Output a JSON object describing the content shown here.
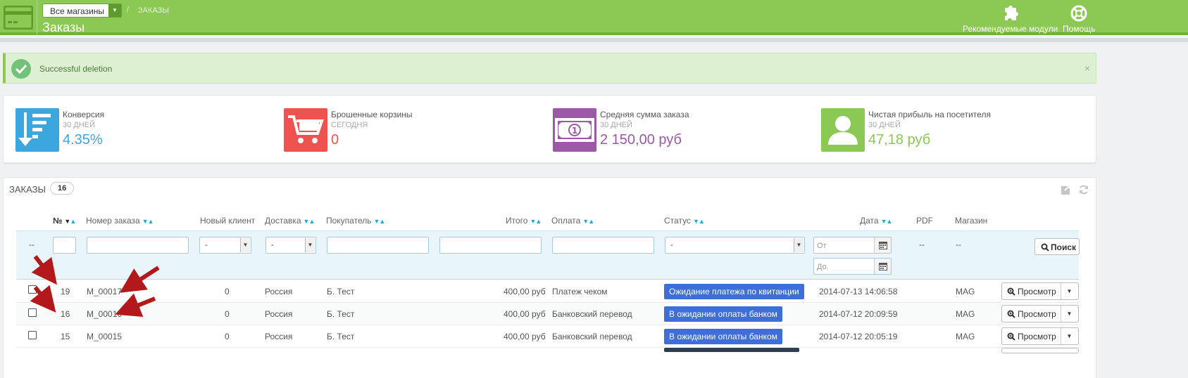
{
  "header": {
    "store_select": "Все магазины",
    "breadcrumb_sep": "/",
    "breadcrumb_current": "ЗАКАЗЫ",
    "page_title": "Заказы",
    "actions": [
      {
        "label": "Рекомендуемые модули",
        "icon": "puzzle-icon"
      },
      {
        "label": "Помощь",
        "icon": "lifebuoy-icon"
      }
    ],
    "color": "#8bc954"
  },
  "alert": {
    "message": "Successful deletion",
    "close": "×"
  },
  "kpis": [
    {
      "title": "Конверсия",
      "period": "30 ДНЕЙ",
      "value": "4.35%",
      "color": "#3ba7de",
      "icon": "funnel-list-icon"
    },
    {
      "title": "Брошенные корзины",
      "period": "СЕГОДНЯ",
      "value": "0",
      "color": "#ef5350",
      "icon": "cart-icon"
    },
    {
      "title": "Средняя сумма заказа",
      "period": "30 ДНЕЙ",
      "value": "2 150,00 руб",
      "color": "#9b59a6",
      "icon": "banknote-icon"
    },
    {
      "title": "Чистая прибыль на посетителя",
      "period": "30 ДНЕЙ",
      "value": "47,18 руб",
      "color": "#8bc954",
      "icon": "user-icon"
    }
  ],
  "orders": {
    "heading": "ЗАКАЗЫ",
    "count": "16",
    "columns": {
      "id": "№",
      "ref": "Номер заказа",
      "new_client": "Новый клиент",
      "delivery": "Доставка",
      "customer": "Покупатель",
      "total": "Итого",
      "payment": "Оплата",
      "status": "Статус",
      "date": "Дата",
      "pdf": "PDF",
      "shop": "Магазин"
    },
    "filters": {
      "dash": "--",
      "new_client_value": "-",
      "delivery_value": "-",
      "status_value": "-",
      "date_from_placeholder": "От",
      "date_to_placeholder": "До.",
      "pdf_dash": "--",
      "shop_dash": "--",
      "search_label": "Поиск"
    },
    "rows": [
      {
        "id": "19",
        "ref": "M_00017",
        "new_client": "0",
        "delivery": "Россия",
        "customer": "Б. Тест",
        "total": "400,00 руб",
        "payment": "Платеж чеком",
        "status": "Ожидание платежа по квитанции",
        "date": "2014-07-13 14:06:58",
        "shop": "MAG",
        "view": "Просмотр"
      },
      {
        "id": "16",
        "ref": "M_00016",
        "new_client": "0",
        "delivery": "Россия",
        "customer": "Б. Тест",
        "total": "400,00 руб",
        "payment": "Банковский перевод",
        "status": "В ожидании оплаты банком",
        "date": "2014-07-12 20:09:59",
        "shop": "MAG",
        "view": "Просмотр"
      },
      {
        "id": "15",
        "ref": "M_00015",
        "new_client": "0",
        "delivery": "Россия",
        "customer": "Б. Тест",
        "total": "400,00 руб",
        "payment": "Банковский перевод",
        "status": "В ожидании оплаты банком",
        "date": "2014-07-12 20:05:19",
        "shop": "MAG",
        "view": "Просмотр"
      }
    ]
  }
}
